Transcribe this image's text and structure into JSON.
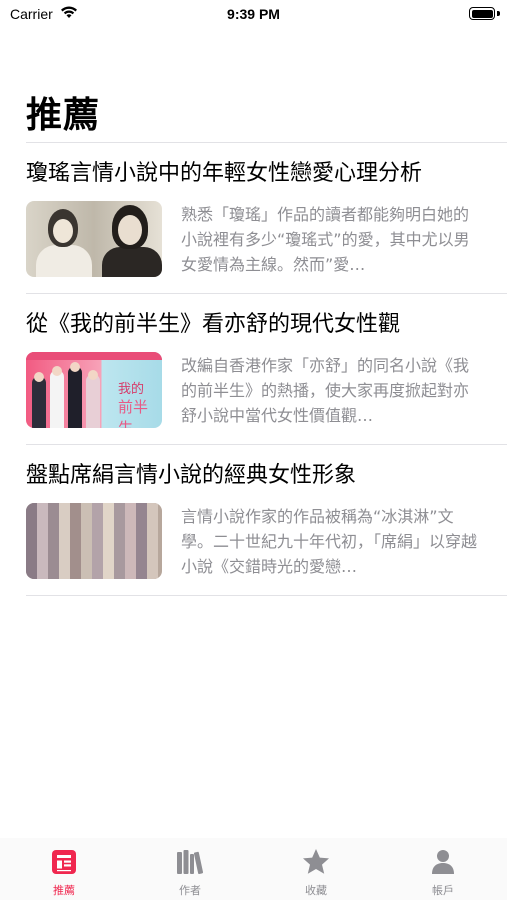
{
  "status_bar": {
    "carrier": "Carrier",
    "time": "9:39 PM",
    "battery_level": 1.0
  },
  "page": {
    "title": "推薦"
  },
  "articles": [
    {
      "title": "瓊瑤言情小說中的年輕女性戀愛心理分析",
      "excerpt": "熟悉「瓊瑤」作品的讀者都能夠明白她的小說裡有多少“瓊瑤式”的愛，其中尤以男女愛情為主線。然而”愛…",
      "thumbnail": "black-and-white photo of two women"
    },
    {
      "title": "從《我的前半生》看亦舒的現代女性觀",
      "excerpt": "改編自香港作家「亦舒」的同名小說《我的前半生》的熱播，使大家再度掀起對亦舒小說中當代女性價值觀…",
      "thumbnail": "drama poster",
      "thumbnail_text_1": "我的",
      "thumbnail_text_2": "前半生"
    },
    {
      "title": "盤點席絹言情小說的經典女性形象",
      "excerpt": "言情小說作家的作品被稱為“冰淇淋”文學。二十世紀九十年代初，「席絹」以穿越小說《交錯時光的愛戀…",
      "thumbnail": "row of books"
    }
  ],
  "tab_bar": {
    "tabs": [
      {
        "label": "推薦",
        "icon": "news-icon",
        "active": true
      },
      {
        "label": "作者",
        "icon": "books-icon",
        "active": false
      },
      {
        "label": "收藏",
        "icon": "star-icon",
        "active": false
      },
      {
        "label": "帳戶",
        "icon": "person-icon",
        "active": false
      }
    ]
  },
  "colors": {
    "accent": "#f0274f",
    "inactive": "#8e8e93",
    "excerpt_text": "#8e8e93"
  }
}
